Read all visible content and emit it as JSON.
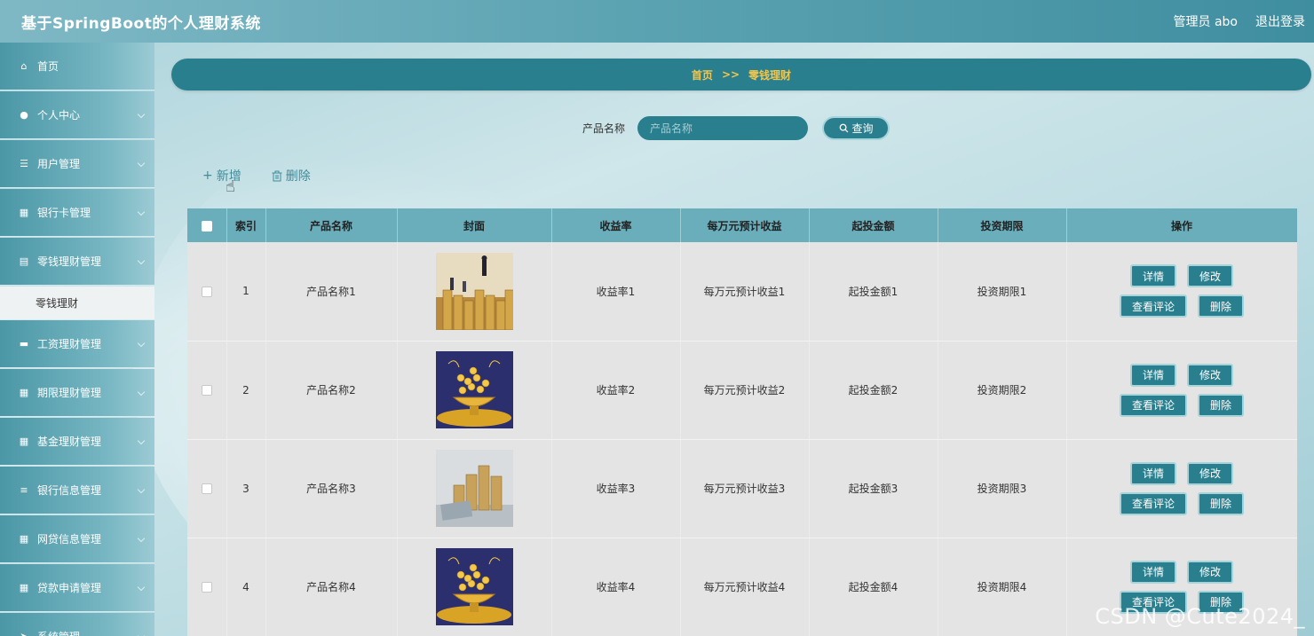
{
  "app_title": "基于SpringBoot的个人理财系统",
  "header": {
    "user_label": "管理员 abo",
    "logout_label": "退出登录"
  },
  "sidebar": {
    "items": [
      {
        "label": "首页",
        "icon": "home-icon",
        "glyph": "⌂",
        "has_children": false
      },
      {
        "label": "个人中心",
        "icon": "user-icon",
        "glyph": "●",
        "has_children": true
      },
      {
        "label": "用户管理",
        "icon": "sliders-icon",
        "glyph": "☰",
        "has_children": true
      },
      {
        "label": "银行卡管理",
        "icon": "grid-icon",
        "glyph": "▦",
        "has_children": true
      },
      {
        "label": "零钱理财管理",
        "icon": "clipboard-icon",
        "glyph": "▤",
        "has_children": true
      },
      {
        "label": "零钱理财",
        "is_sub": true
      },
      {
        "label": "工资理财管理",
        "icon": "ticket-icon",
        "glyph": "▬",
        "has_children": true
      },
      {
        "label": "期限理财管理",
        "icon": "grid-icon",
        "glyph": "▦",
        "has_children": true
      },
      {
        "label": "基金理财管理",
        "icon": "grid-icon",
        "glyph": "▦",
        "has_children": true
      },
      {
        "label": "银行信息管理",
        "icon": "list-icon",
        "glyph": "≡",
        "has_children": true
      },
      {
        "label": "网贷信息管理",
        "icon": "grid-icon",
        "glyph": "▦",
        "has_children": true
      },
      {
        "label": "贷款申请管理",
        "icon": "grid-icon",
        "glyph": "▦",
        "has_children": true
      },
      {
        "label": "系统管理",
        "icon": "send-icon",
        "glyph": "➤",
        "has_children": true
      }
    ]
  },
  "breadcrumb": {
    "home": "首页",
    "sep": ">>",
    "current": "零钱理财"
  },
  "search": {
    "label": "产品名称",
    "placeholder": "产品名称",
    "button": "查询"
  },
  "actions": {
    "add": "新增",
    "delete": "删除"
  },
  "table": {
    "headers": [
      "",
      "索引",
      "产品名称",
      "封面",
      "收益率",
      "每万元预计收益",
      "起投金额",
      "投资期限",
      "操作"
    ],
    "row_buttons": {
      "detail": "详情",
      "edit": "修改",
      "comments": "查看评论",
      "delete": "删除"
    },
    "rows": [
      {
        "index": "1",
        "name": "产品名称1",
        "cover": "business-coins",
        "rate": "收益率1",
        "per10k": "每万元预计收益1",
        "min": "起投金额1",
        "term": "投资期限1"
      },
      {
        "index": "2",
        "name": "产品名称2",
        "cover": "gold-bowl",
        "rate": "收益率2",
        "per10k": "每万元预计收益2",
        "min": "起投金额2",
        "term": "投资期限2"
      },
      {
        "index": "3",
        "name": "产品名称3",
        "cover": "coin-stacks",
        "rate": "收益率3",
        "per10k": "每万元预计收益3",
        "min": "起投金额3",
        "term": "投资期限3"
      },
      {
        "index": "4",
        "name": "产品名称4",
        "cover": "gold-bowl",
        "rate": "收益率4",
        "per10k": "每万元预计收益4",
        "min": "起投金额4",
        "term": "投资期限4"
      }
    ]
  },
  "watermark": "CSDN @Cute2024_",
  "colors": {
    "primary": "#2a7f8f",
    "accent_text": "#f3c64c",
    "table_header": "#6aadbb"
  }
}
